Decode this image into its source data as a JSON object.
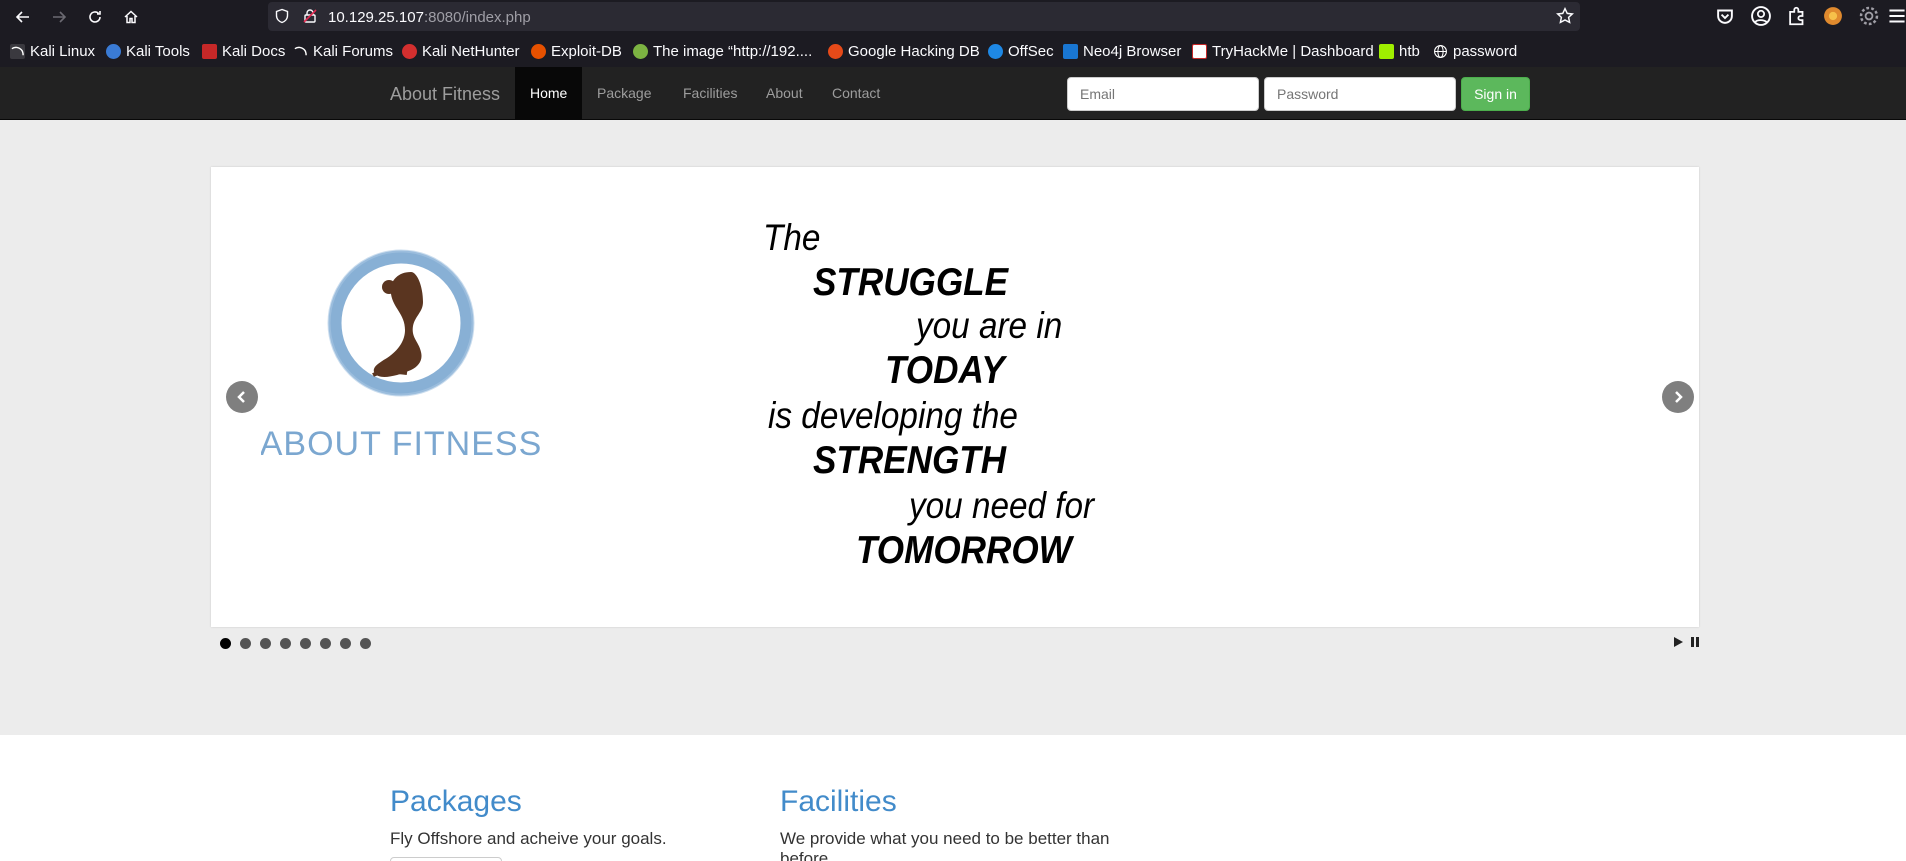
{
  "browser": {
    "url_host": "10.129.25.107",
    "url_rest": ":8080/index.php",
    "bookmarks": [
      {
        "label": "Kali Linux",
        "icon": "kali-dragon-icon"
      },
      {
        "label": "Kali Tools",
        "icon": "kali-tools-icon"
      },
      {
        "label": "Kali Docs",
        "icon": "kali-docs-icon"
      },
      {
        "label": "Kali Forums",
        "icon": "kali-dragon-icon"
      },
      {
        "label": "Kali NetHunter",
        "icon": "nethunter-icon"
      },
      {
        "label": "Exploit-DB",
        "icon": "exploit-db-icon"
      },
      {
        "label": "The image “http://192....",
        "icon": "image-bookmark-icon"
      },
      {
        "label": "Google Hacking DB",
        "icon": "ghdb-icon"
      },
      {
        "label": "OffSec",
        "icon": "offsec-icon"
      },
      {
        "label": "Neo4j Browser",
        "icon": "neo4j-icon"
      },
      {
        "label": "TryHackMe | Dashboard",
        "icon": "tryhackme-icon"
      },
      {
        "label": "htb",
        "icon": "htb-icon"
      },
      {
        "label": "password",
        "icon": "globe-icon"
      }
    ]
  },
  "navbar": {
    "brand": "About Fitness",
    "items": [
      "Home",
      "Package",
      "Facilities",
      "About",
      "Contact"
    ],
    "active": "Home",
    "email_placeholder": "Email",
    "password_placeholder": "Password",
    "signin_label": "Sign in"
  },
  "carousel": {
    "logo_text": "ABOUT FITNESS",
    "quote_lines": [
      "The",
      "STRUGGLE",
      "you are in",
      "TODAY",
      "is developing the",
      "STRENGTH",
      "you need for",
      "TOMORROW"
    ],
    "slide_count": 8,
    "active_slide": 1
  },
  "sections": [
    {
      "title": "Packages",
      "text": "Fly Offshore and acheive your goals."
    },
    {
      "title": "Facilities",
      "text": "We provide what you need to be better than before."
    }
  ],
  "colors": {
    "navbar_bg": "#222222",
    "active_nav_bg": "#080808",
    "signin_green": "#5cb85c",
    "heading_blue": "#428bca",
    "logo_blue": "#7ba7d0",
    "logo_figure": "#5a3520"
  }
}
